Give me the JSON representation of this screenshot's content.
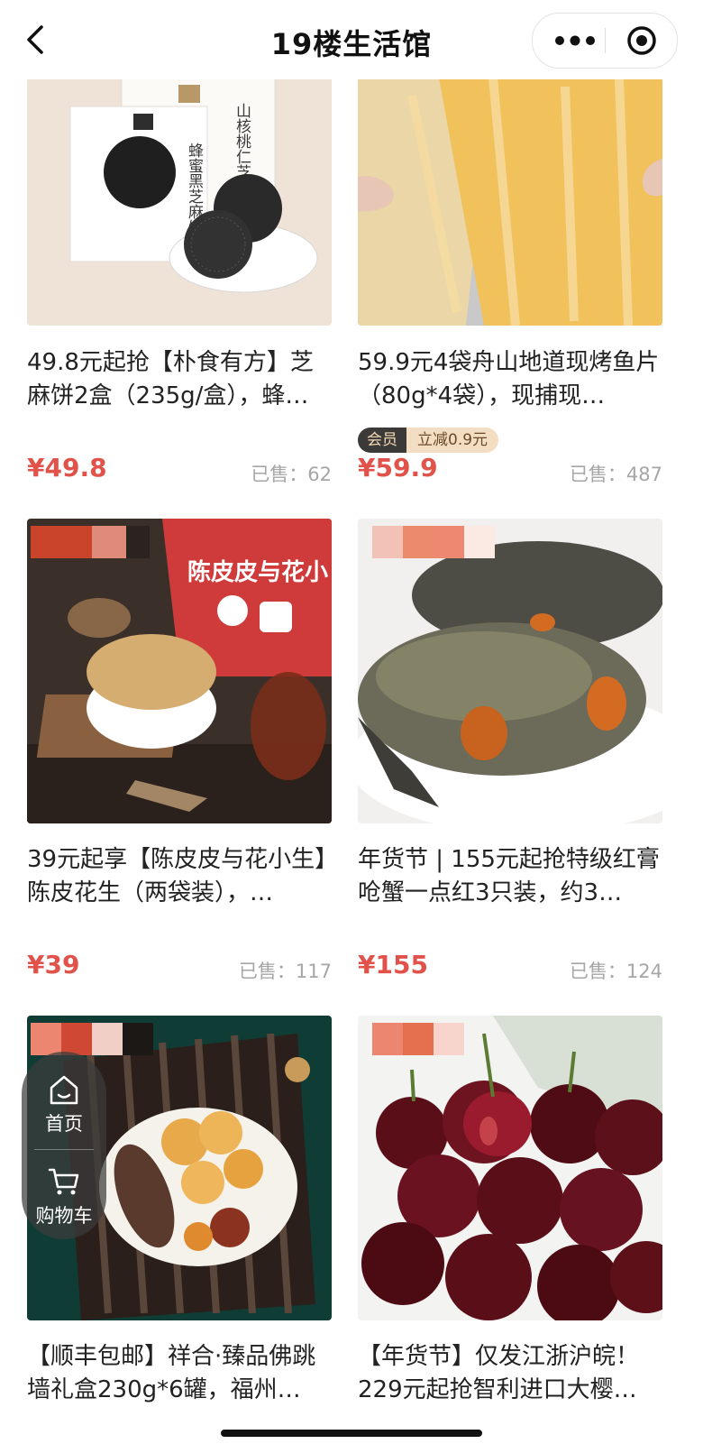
{
  "header": {
    "title": "19楼生活馆"
  },
  "products": [
    {
      "name": "49.8元起抢【朴食有方】芝麻饼2盒（235g/盒），蜂…",
      "price": "¥49.8",
      "sold": "已售：62"
    },
    {
      "name": "59.9元4袋舟山地道现烤鱼片（80g*4袋），现捕现…",
      "price": "¥59.9",
      "sold": "已售：487",
      "member_tag": "会员",
      "member_discount": "立减0.9元"
    },
    {
      "name": "39元起享【陈皮皮与花小生】陈皮花生（两袋装），…",
      "price": "¥39",
      "sold": "已售：117"
    },
    {
      "name": "年货节 | 155元起抢特级红膏呛蟹一点红3只装，约3…",
      "price": "¥155",
      "sold": "已售：124"
    },
    {
      "name": "【顺丰包邮】祥合·臻品佛跳墙礼盒230g*6罐，福州…"
    },
    {
      "name": "【年货节】仅发江浙沪皖！229元起抢智利进口大樱…"
    }
  ],
  "product_image_text": {
    "sesame_box1": "蜂蜜黑芝麻饼",
    "sesame_box2": "山核桃仁芝麻",
    "peanut_bag": "陈皮皮与花小"
  },
  "floating_nav": {
    "home_label": "首页",
    "cart_label": "购物车"
  },
  "colors": {
    "price": "#e0524a",
    "member_dark": "#3b3a39",
    "member_light": "#f3ddc3"
  }
}
